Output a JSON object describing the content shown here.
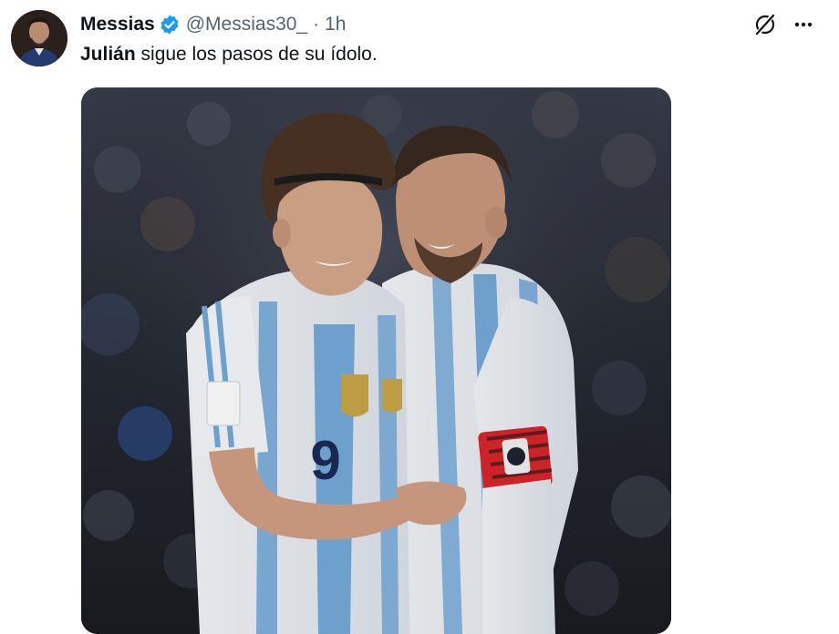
{
  "post": {
    "author": {
      "display_name": "Messias",
      "handle": "@Messias30_",
      "verified": true,
      "avatar_icon": "profile-photo"
    },
    "separator": "·",
    "time": "1h",
    "text": {
      "mention": "Julián",
      "rest": " sigue los pasos de su ídolo."
    },
    "actions": {
      "grok_icon": "grok-icon",
      "more_icon": "more-horizontal-icon"
    },
    "media": {
      "kind": "photo",
      "jersey_number": "9"
    }
  },
  "colors": {
    "text_primary": "#0f1419",
    "text_secondary": "#536471",
    "verified_blue": "#1d9bf0",
    "argentina_sky_blue": "#75aadb",
    "captain_armband": "#d8262b"
  }
}
